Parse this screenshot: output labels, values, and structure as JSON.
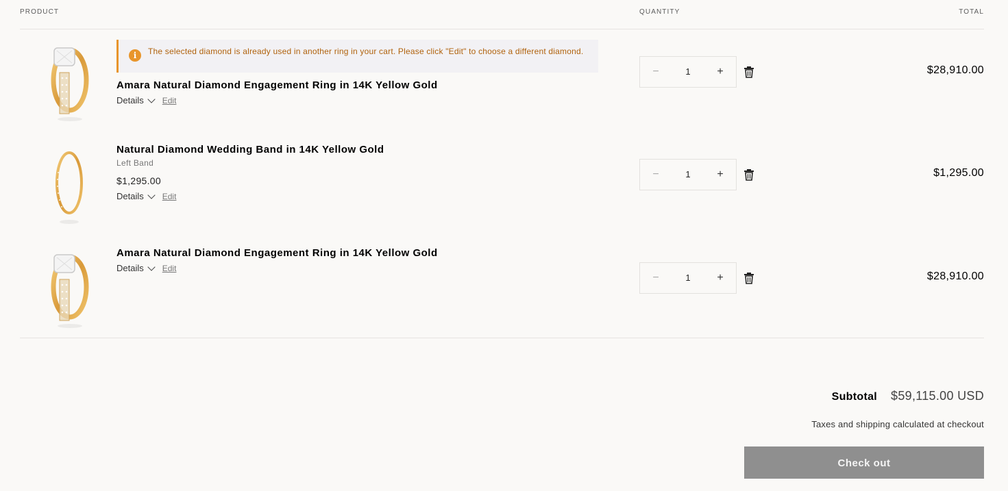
{
  "header": {
    "product": "PRODUCT",
    "quantity": "QUANTITY",
    "total": "TOTAL"
  },
  "alert": {
    "icon": "info-icon",
    "text": "The selected diamond is already used in another ring in your cart. Please click \"Edit\" to choose a different diamond."
  },
  "items": [
    {
      "title": "Amara Natural Diamond Engagement Ring in 14K Yellow Gold",
      "details_label": "Details",
      "edit_label": "Edit",
      "quantity": "1",
      "total": "$28,910.00",
      "image": "engagement-ring-image"
    },
    {
      "title": "Natural Diamond Wedding Band in 14K Yellow Gold",
      "variant": "Left Band",
      "unit_price": "$1,295.00",
      "details_label": "Details",
      "edit_label": "Edit",
      "quantity": "1",
      "total": "$1,295.00",
      "image": "wedding-band-image"
    },
    {
      "title": "Amara Natural Diamond Engagement Ring in 14K Yellow Gold",
      "details_label": "Details",
      "edit_label": "Edit",
      "quantity": "1",
      "total": "$28,910.00",
      "image": "engagement-ring-image"
    }
  ],
  "quantity_controls": {
    "minus": "−",
    "plus": "+"
  },
  "summary": {
    "subtotal_label": "Subtotal",
    "subtotal_value": "$59,115.00 USD",
    "tax_note": "Taxes and shipping calculated at checkout",
    "checkout_label": "Check out"
  },
  "colors": {
    "background": "#faf9f7",
    "alert_accent": "#e8952b",
    "alert_text": "#b0620c",
    "checkout_bg": "#8f8f8f"
  }
}
